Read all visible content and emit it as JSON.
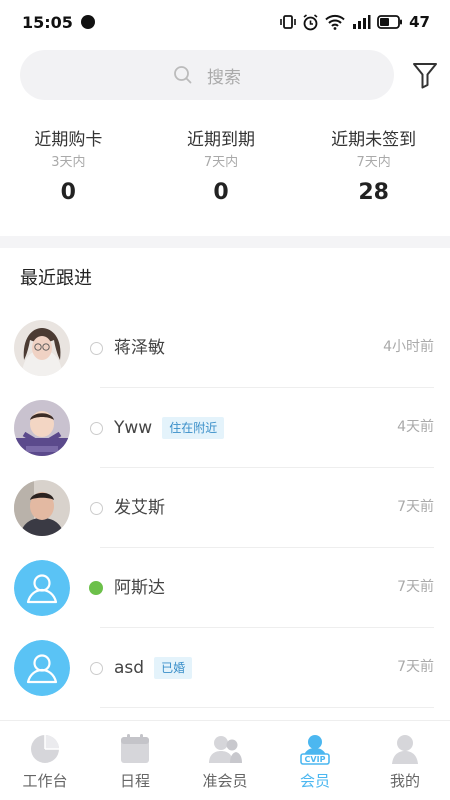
{
  "status_bar": {
    "time": "15:05",
    "battery": "47"
  },
  "search": {
    "placeholder": "搜索"
  },
  "stats": [
    {
      "title": "近期购卡",
      "sub": "3天内",
      "value": "0"
    },
    {
      "title": "近期到期",
      "sub": "7天内",
      "value": "0"
    },
    {
      "title": "近期未签到",
      "sub": "7天内",
      "value": "28"
    }
  ],
  "section_title": "最近跟进",
  "members": [
    {
      "name": "蒋泽敏",
      "tag": "",
      "time": "4小时前",
      "online": false,
      "avatar": "photo-woman"
    },
    {
      "name": "Yww",
      "tag": "住在附近",
      "time": "4天前",
      "online": false,
      "avatar": "photo-baby"
    },
    {
      "name": "发艾斯",
      "tag": "",
      "time": "7天前",
      "online": false,
      "avatar": "photo-man"
    },
    {
      "name": "阿斯达",
      "tag": "",
      "time": "7天前",
      "online": true,
      "avatar": "default-user-icon"
    },
    {
      "name": "asd",
      "tag": "已婚",
      "time": "7天前",
      "online": false,
      "avatar": "default-user-icon"
    }
  ],
  "tabs": [
    {
      "label": "工作台",
      "icon": "pie-chart-icon",
      "active": false
    },
    {
      "label": "日程",
      "icon": "calendar-icon",
      "active": false
    },
    {
      "label": "准会员",
      "icon": "prospects-icon",
      "active": false
    },
    {
      "label": "会员",
      "icon": "vip-member-icon",
      "active": true
    },
    {
      "label": "我的",
      "icon": "profile-icon",
      "active": false
    }
  ],
  "colors": {
    "accent": "#4cb7f0",
    "online": "#6cc04a",
    "tag_bg": "#e4f3fb",
    "tag_text": "#3a8fc9"
  }
}
